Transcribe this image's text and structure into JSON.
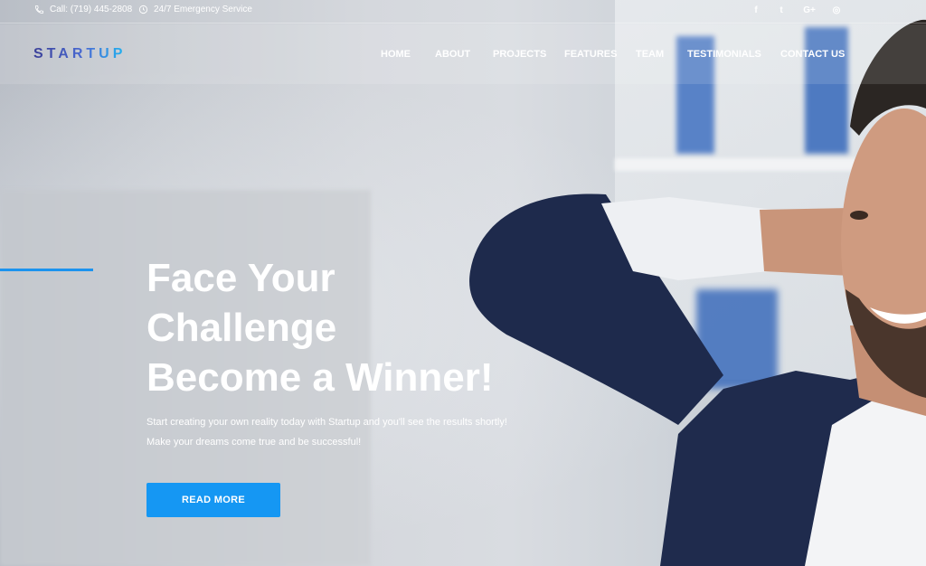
{
  "topbar": {
    "phone": "Call: (719) 445-2808",
    "service": "24/7 Emergency Service",
    "social": [
      {
        "icon": "facebook-icon",
        "glyph": "f"
      },
      {
        "icon": "twitter-icon",
        "glyph": "t"
      },
      {
        "icon": "google-plus-icon",
        "glyph": "G+"
      },
      {
        "icon": "instagram-icon",
        "glyph": "◎"
      }
    ]
  },
  "header": {
    "logo": "STARTUP",
    "nav": [
      "HOME",
      "ABOUT",
      "PROJECTS",
      "FEATURES",
      "TEAM",
      "TESTIMONIALS",
      "CONTACT US"
    ]
  },
  "hero": {
    "headline": [
      "Face Your",
      "Challenge",
      "Become a Winner!"
    ],
    "subtext": [
      "Start creating your own reality today with Startup and you'll see the results shortly!",
      "Make your dreams come true and be successful!"
    ],
    "cta": "READ MORE"
  },
  "colors": {
    "accent": "#1597f3",
    "logo_start": "#3a3f98",
    "logo_end": "#20b4f0"
  }
}
